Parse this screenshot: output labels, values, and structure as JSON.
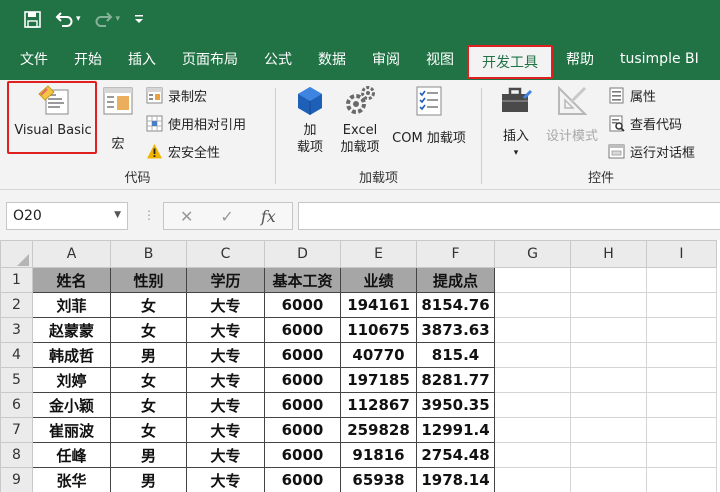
{
  "qat": {
    "save_icon": "save-icon",
    "undo_icon": "undo-icon",
    "redo_icon": "redo-icon",
    "customize_icon": "customize-qat-icon"
  },
  "tabs": [
    {
      "label": "文件",
      "active": false
    },
    {
      "label": "开始",
      "active": false
    },
    {
      "label": "插入",
      "active": false
    },
    {
      "label": "页面布局",
      "active": false
    },
    {
      "label": "公式",
      "active": false
    },
    {
      "label": "数据",
      "active": false
    },
    {
      "label": "审阅",
      "active": false
    },
    {
      "label": "视图",
      "active": false
    },
    {
      "label": "开发工具",
      "active": true
    },
    {
      "label": "帮助",
      "active": false
    },
    {
      "label": "tusimple BI",
      "active": false
    }
  ],
  "ribbon": {
    "code": {
      "group_label": "代码",
      "visual_basic": "Visual Basic",
      "macros": "宏",
      "record_macro": "录制宏",
      "relative_ref": "使用相对引用",
      "macro_security": "宏安全性"
    },
    "addins": {
      "group_label": "加载项",
      "addins_line1": "加",
      "addins_line2": "载项",
      "excel_addins_line1": "Excel",
      "excel_addins_line2": "加载项",
      "com_addins": "COM 加载项"
    },
    "controls": {
      "group_label": "控件",
      "insert": "插入",
      "design_mode": "设计模式",
      "properties": "属性",
      "view_code": "查看代码",
      "run_dialog": "运行对话框"
    }
  },
  "formula_bar": {
    "name_box": "O20",
    "cancel_symbol": "✕",
    "enter_symbol": "✓",
    "fx_label": "fx",
    "formula": ""
  },
  "sheet": {
    "columns": [
      "A",
      "B",
      "C",
      "D",
      "E",
      "F",
      "G",
      "H",
      "I"
    ],
    "rows": [
      "1",
      "2",
      "3",
      "4",
      "5",
      "6",
      "7",
      "8",
      "9"
    ],
    "header": [
      "姓名",
      "性别",
      "学历",
      "基本工资",
      "业绩",
      "提成点"
    ],
    "data": [
      [
        "刘菲",
        "女",
        "大专",
        "6000",
        "194161",
        "8154.76"
      ],
      [
        "赵蒙蒙",
        "女",
        "大专",
        "6000",
        "110675",
        "3873.63"
      ],
      [
        "韩成哲",
        "男",
        "大专",
        "6000",
        "40770",
        "815.4"
      ],
      [
        "刘婷",
        "女",
        "大专",
        "6000",
        "197185",
        "8281.77"
      ],
      [
        "金小颖",
        "女",
        "大专",
        "6000",
        "112867",
        "3950.35"
      ],
      [
        "崔丽波",
        "女",
        "大专",
        "6000",
        "259828",
        "12991.4"
      ],
      [
        "任峰",
        "男",
        "大专",
        "6000",
        "91816",
        "2754.48"
      ],
      [
        "张华",
        "男",
        "大专",
        "6000",
        "65938",
        "1978.14"
      ]
    ]
  },
  "colors": {
    "excel_green": "#217346",
    "highlight_red": "#e02020",
    "header_fill": "#a6a6a6"
  }
}
